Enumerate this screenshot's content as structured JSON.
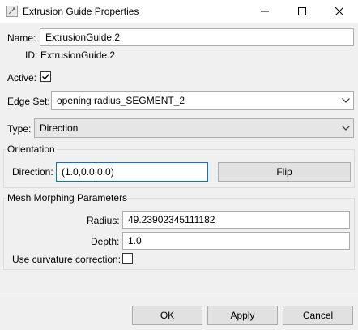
{
  "window": {
    "title": "Extrusion Guide Properties",
    "icon": "properties-window-icon",
    "controls": [
      "minimize-icon",
      "maximize-icon",
      "close-icon"
    ]
  },
  "form": {
    "name_label": "Name:",
    "name_value": "ExtrusionGuide.2",
    "id_label": "ID:",
    "id_value": "ExtrusionGuide.2",
    "active_label": "Active:",
    "active_checked": true,
    "edge_set_label": "Edge Set:",
    "edge_set_value": "opening radius_SEGMENT_2",
    "type_label": "Type:",
    "type_value": "Direction"
  },
  "orientation": {
    "group_label": "Orientation",
    "direction_label": "Direction:",
    "direction_value": "(1.0,0.0,0.0)",
    "flip_label": "Flip"
  },
  "mesh": {
    "group_label": "Mesh Morphing Parameters",
    "radius_label": "Radius:",
    "radius_value": "49.23902345111182",
    "depth_label": "Depth:",
    "depth_value": "1.0",
    "curvature_label": "Use curvature correction:",
    "curvature_checked": false
  },
  "footer": {
    "ok_label": "OK",
    "apply_label": "Apply",
    "cancel_label": "Cancel"
  }
}
